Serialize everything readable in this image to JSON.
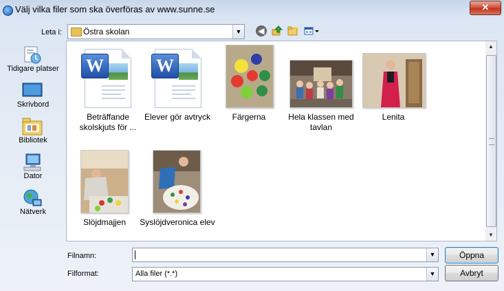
{
  "window": {
    "title": "Välj vilka filer som ska överföras av www.sunne.se",
    "close_label": "✕"
  },
  "toolbar": {
    "look_in_label": "Leta i:",
    "look_in_value": "Östra skolan",
    "icons": [
      "back-icon",
      "up-folder-icon",
      "new-folder-icon",
      "view-menu-icon"
    ]
  },
  "places": [
    {
      "label": "Tidigare platser",
      "icon": "recent-places-icon"
    },
    {
      "label": "Skrivbord",
      "icon": "desktop-icon"
    },
    {
      "label": "Bibliotek",
      "icon": "libraries-icon"
    },
    {
      "label": "Dator",
      "icon": "computer-icon"
    },
    {
      "label": "Nätverk",
      "icon": "network-icon"
    }
  ],
  "files": [
    {
      "name": "Beträffande skolskjuts för ...",
      "type": "word"
    },
    {
      "name": "Elever gör avtryck",
      "type": "word"
    },
    {
      "name": "Färgerna",
      "type": "photo"
    },
    {
      "name": "Hela klassen med tavlan",
      "type": "photo"
    },
    {
      "name": "Lenita",
      "type": "photo"
    },
    {
      "name": "Slöjdmajjen",
      "type": "photo"
    },
    {
      "name": "Syslöjdveronica elev",
      "type": "photo"
    }
  ],
  "footer": {
    "filename_label": "Filnamn:",
    "filename_value": "",
    "filetype_label": "Filformat:",
    "filetype_value": "Alla filer (*.*)",
    "open_label": "Öppna",
    "cancel_label": "Avbryt"
  }
}
